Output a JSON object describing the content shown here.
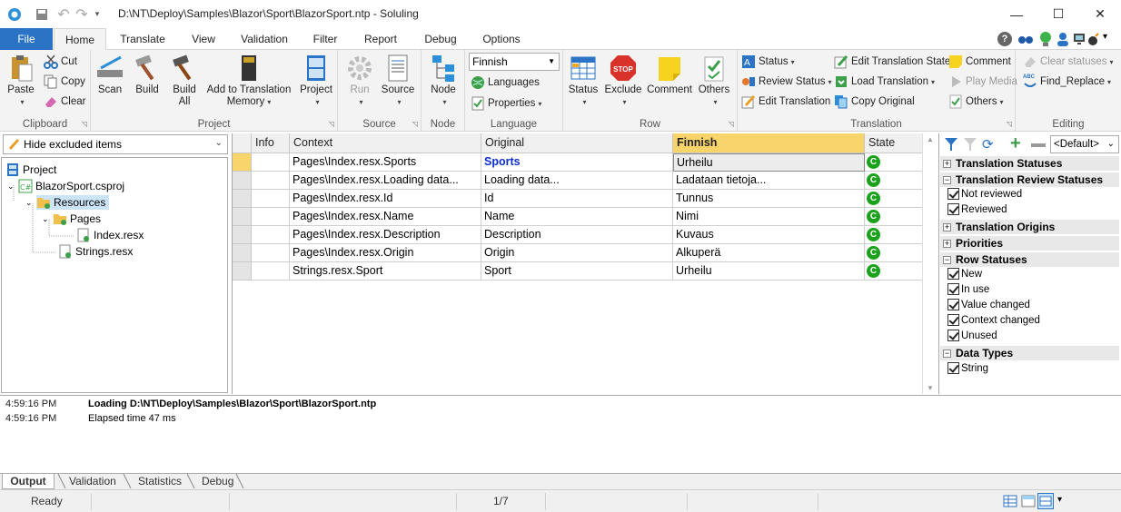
{
  "window": {
    "title": "D:\\NT\\Deploy\\Samples\\Blazor\\Sport\\BlazorSport.ntp  -  Soluling"
  },
  "ribbon_tabs": [
    "File",
    "Home",
    "Translate",
    "View",
    "Validation",
    "Filter",
    "Report",
    "Debug",
    "Options"
  ],
  "ribbon": {
    "clipboard": {
      "label": "Clipboard",
      "paste": "Paste",
      "cut": "Cut",
      "copy": "Copy",
      "clear": "Clear"
    },
    "project": {
      "label": "Project",
      "scan": "Scan",
      "build": "Build",
      "build_all_1": "Build",
      "build_all_2": "All",
      "add_tm_1": "Add to Translation",
      "add_tm_2": "Memory",
      "project": "Project"
    },
    "source": {
      "label": "Source",
      "run": "Run",
      "source": "Source"
    },
    "node": {
      "label": "Node",
      "node": "Node"
    },
    "language": {
      "label": "Language",
      "selected": "Finnish",
      "languages": "Languages",
      "properties": "Properties"
    },
    "row": {
      "label": "Row",
      "status": "Status",
      "exclude": "Exclude",
      "stop": "STOP",
      "comment": "Comment",
      "others": "Others"
    },
    "translation": {
      "label": "Translation",
      "status": "Status",
      "review_status": "Review Status",
      "edit_translation": "Edit Translation",
      "edit_translation_state": "Edit Translation State",
      "load_translation": "Load Translation",
      "copy_original": "Copy Original",
      "comment": "Comment",
      "play_media": "Play Media",
      "others": "Others"
    },
    "editing": {
      "label": "Editing",
      "clear_statuses": "Clear statuses",
      "find_replace": "Find_Replace",
      "abc": "ABC"
    }
  },
  "left_panel": {
    "filter": "Hide excluded items",
    "tree": [
      "Project",
      "BlazorSport.csproj",
      "Resources",
      "Pages",
      "Index.resx",
      "Strings.resx"
    ]
  },
  "grid": {
    "columns": [
      "Info",
      "Context",
      "Original",
      "Finnish",
      "State"
    ],
    "rows": [
      {
        "context": "Pages\\Index.resx.Sports",
        "original": "Sports",
        "finnish": "Urheilu",
        "state": "C"
      },
      {
        "context": "Pages\\Index.resx.Loading data...",
        "original": "Loading data...",
        "finnish": "Ladataan tietoja...",
        "state": "C"
      },
      {
        "context": "Pages\\Index.resx.Id",
        "original": "Id",
        "finnish": "Tunnus",
        "state": "C"
      },
      {
        "context": "Pages\\Index.resx.Name",
        "original": "Name",
        "finnish": "Nimi",
        "state": "C"
      },
      {
        "context": "Pages\\Index.resx.Description",
        "original": "Description",
        "finnish": "Kuvaus",
        "state": "C"
      },
      {
        "context": "Pages\\Index.resx.Origin",
        "original": "Origin",
        "finnish": "Alkuperä",
        "state": "C"
      },
      {
        "context": "Strings.resx.Sport",
        "original": "Sport",
        "finnish": "Urheilu",
        "state": "C"
      }
    ]
  },
  "right_panel": {
    "preset": "<Default>",
    "sections": [
      {
        "title": "Translation Statuses",
        "expanded": false,
        "items": []
      },
      {
        "title": "Translation Review Statuses",
        "expanded": true,
        "items": [
          "Not reviewed",
          "Reviewed"
        ]
      },
      {
        "title": "Translation Origins",
        "expanded": false,
        "items": []
      },
      {
        "title": "Priorities",
        "expanded": false,
        "items": []
      },
      {
        "title": "Row Statuses",
        "expanded": true,
        "items": [
          "New",
          "In use",
          "Value changed",
          "Context changed",
          "Unused"
        ]
      },
      {
        "title": "Data Types",
        "expanded": true,
        "items": [
          "String"
        ]
      }
    ]
  },
  "output": {
    "lines": [
      {
        "time": "4:59:16 PM",
        "msg": "Loading D:\\NT\\Deploy\\Samples\\Blazor\\Sport\\BlazorSport.ntp",
        "bold": true
      },
      {
        "time": "4:59:16 PM",
        "msg": "Elapsed time 47 ms",
        "bold": false
      }
    ],
    "tabs": [
      "Output",
      "Validation",
      "Statistics",
      "Debug"
    ]
  },
  "statusbar": {
    "status": "Ready",
    "position": "1/7"
  },
  "colors": {
    "accent": "#2b73c4",
    "finnish_header": "#f9d46a",
    "state_ok": "#1aa21a",
    "selected_tree": "#cce4f7"
  }
}
